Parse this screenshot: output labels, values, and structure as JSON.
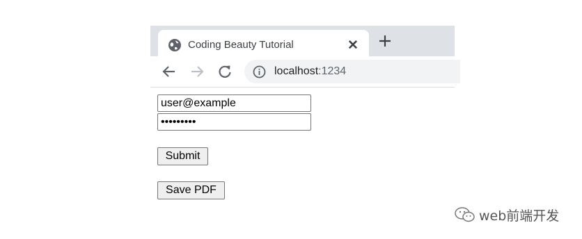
{
  "browser": {
    "tab": {
      "title": "Coding Beauty Tutorial",
      "favicon": "globe-icon",
      "close_symbol": "✕"
    },
    "new_tab_icon": "plus-icon",
    "toolbar": {
      "back_icon": "arrow-left-icon",
      "forward_icon": "arrow-right-icon",
      "reload_icon": "reload-icon",
      "info_icon": "info-icon",
      "url_host": "localhost",
      "url_port": ":1234"
    }
  },
  "form": {
    "email_value": "user@example",
    "password_value": "•••••••••",
    "submit_label": "Submit",
    "save_pdf_label": "Save PDF"
  },
  "watermark": {
    "text": "web前端开发"
  },
  "colors": {
    "tabstrip": "#dee1e6",
    "omnibox": "#f1f3f4",
    "button_bg": "#efefef",
    "border": "#767676"
  }
}
